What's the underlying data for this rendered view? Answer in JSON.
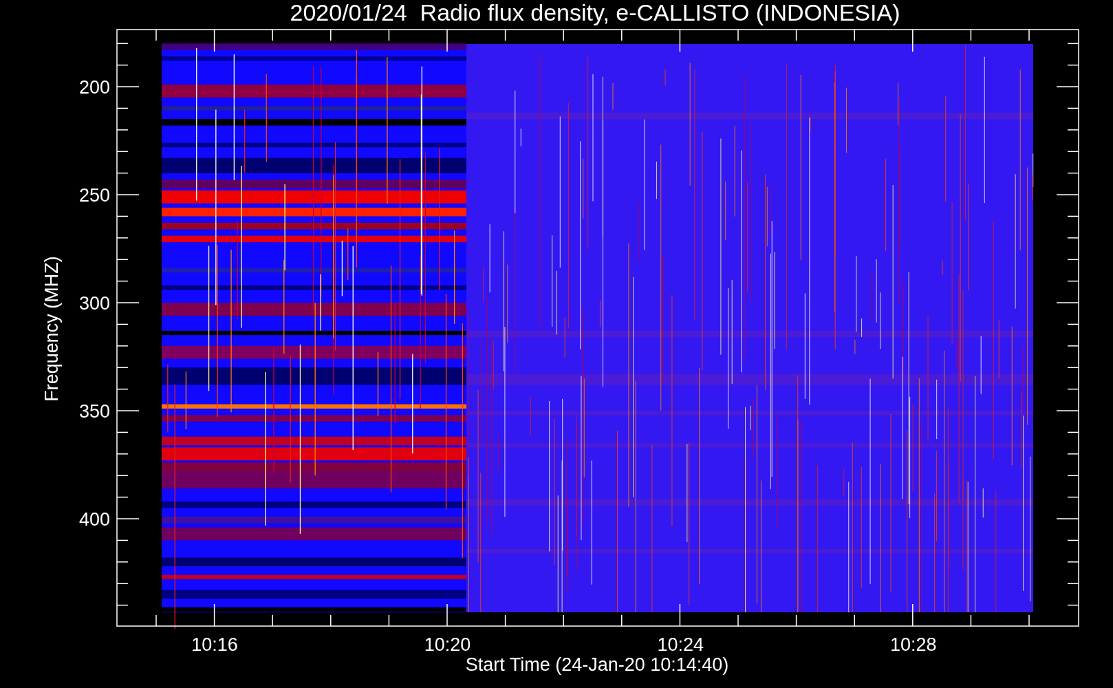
{
  "title": "2020/01/24  Radio flux density, e-CALLISTO (INDONESIA)",
  "y_axis": {
    "label": "Frequency (MHZ)",
    "ticks": [
      "200",
      "250",
      "300",
      "350",
      "400"
    ]
  },
  "x_axis": {
    "label": "Start Time (24-Jan-20 10:14:40)",
    "ticks": [
      "10:16",
      "10:20",
      "10:24",
      "10:28"
    ]
  }
}
